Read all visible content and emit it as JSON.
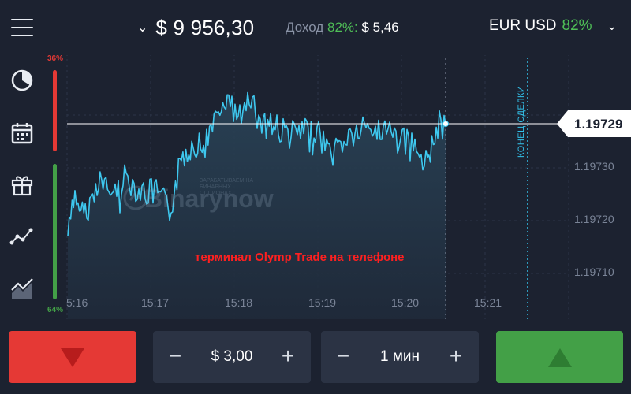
{
  "header": {
    "balance": "$ 9 956,30",
    "income_label": "Доход",
    "income_percent": "82%:",
    "income_value": "$ 5,46",
    "pair_name": "EUR USD",
    "pair_percent": "82%"
  },
  "sentiment": {
    "sell_percent": "36%",
    "buy_percent": "64%"
  },
  "chart": {
    "current_price": "1.19729",
    "price_axis": [
      "1.19730",
      "1.19720",
      "1.19710"
    ],
    "time_axis": [
      "5:16",
      "15:17",
      "15:18",
      "15:19",
      "15:20",
      "15:21"
    ],
    "expiry_label": "КОНЕЦ СДЕЛКИ",
    "watermark_small": "ЗАРАБАТЫВАЕМ НА БИНАРНЫХ ОПЦИОНАХ",
    "watermark_big": "Binarynow",
    "caption": "терминал Olymp Trade на телефоне"
  },
  "controls": {
    "amount": "$ 3,00",
    "duration": "1 мин",
    "minus_glyph": "−",
    "plus_glyph": "+"
  },
  "colors": {
    "background": "#1c2230",
    "line": "#3ec8ef",
    "down": "#e53935",
    "up": "#43a047",
    "accent_green": "#4fbf57"
  },
  "icons": {
    "menu": "hamburger-menu-icon",
    "clock": "clock-icon",
    "calendar": "calendar-icon",
    "gift": "gift-icon",
    "indicators": "line-indicators-icon",
    "chart_type": "area-chart-icon",
    "down": "triangle-down-icon",
    "up": "triangle-up-icon"
  }
}
